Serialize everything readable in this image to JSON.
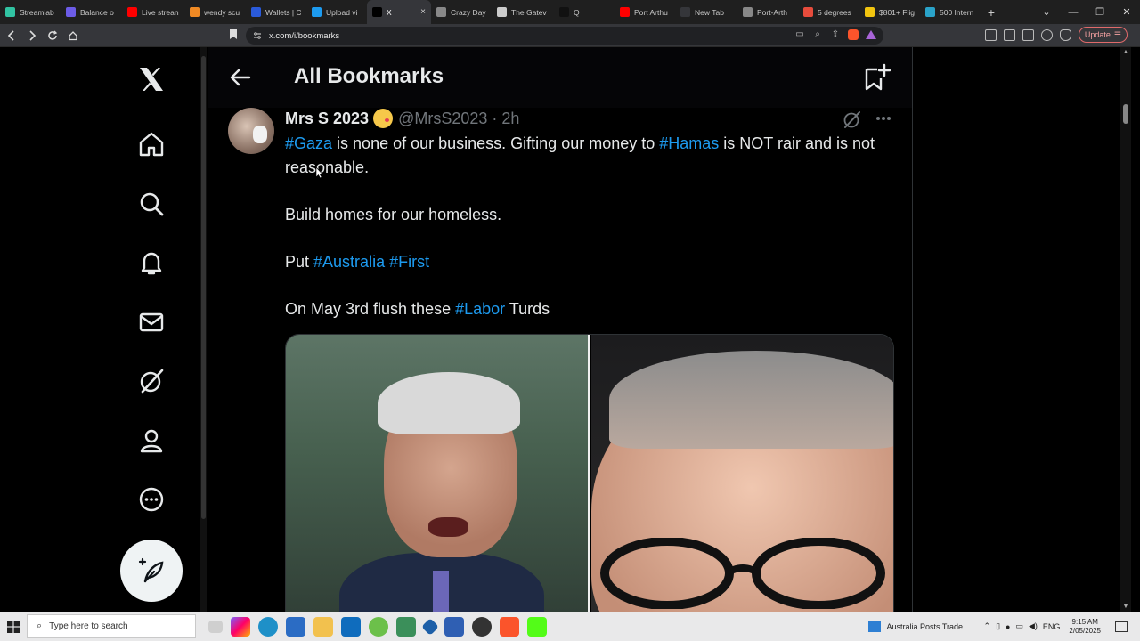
{
  "browser": {
    "tabs": [
      {
        "label": "Streamlab",
        "color": "#31c3a2",
        "active": false
      },
      {
        "label": "Balance o",
        "color": "#6c5ce7",
        "active": false
      },
      {
        "label": "Live strean",
        "color": "#ff0000",
        "active": false
      },
      {
        "label": "wendy scu",
        "color": "#f08a24",
        "active": false
      },
      {
        "label": "Wallets | C",
        "color": "#2a5ada",
        "active": false
      },
      {
        "label": "Upload vi",
        "color": "#1d9bf0",
        "active": false
      },
      {
        "label": "X",
        "color": "#000000",
        "active": true
      },
      {
        "label": "Crazy Day",
        "color": "#888888",
        "active": false
      },
      {
        "label": "The Gatev",
        "color": "#cccccc",
        "active": false
      },
      {
        "label": "Q",
        "color": "#111111",
        "active": false
      },
      {
        "label": "Port Arthu",
        "color": "#ff0000",
        "active": false
      },
      {
        "label": "New Tab",
        "color": "#35363a",
        "active": false
      },
      {
        "label": "Port-Arth",
        "color": "#888888",
        "active": false
      },
      {
        "label": "5 degrees",
        "color": "#e74c3c",
        "active": false
      },
      {
        "label": "$801+ Flig",
        "color": "#f1c40f",
        "active": false
      },
      {
        "label": "500 Intern",
        "color": "#2aa3c9",
        "active": false
      }
    ],
    "close_glyph": "×",
    "new_tab_glyph": "+",
    "url": "x.com/i/bookmarks",
    "update_label": "Update"
  },
  "page": {
    "header_title": "All Bookmarks"
  },
  "tweet": {
    "display_name": "Mrs S 2023",
    "handle": "@MrsS2023",
    "separator": "·",
    "time": "2h",
    "lines": [
      [
        {
          "t": "#Gaza",
          "tag": true
        },
        {
          "t": " is none of our business. Gifting our money to ",
          "tag": false
        },
        {
          "t": "#Hamas",
          "tag": true
        },
        {
          "t": " is NOT rair and is not reasonable.",
          "tag": false
        }
      ],
      [],
      [
        {
          "t": "Build homes for our homeless.",
          "tag": false
        }
      ],
      [],
      [
        {
          "t": "Put ",
          "tag": false
        },
        {
          "t": "#Australia",
          "tag": true
        },
        {
          "t": " ",
          "tag": false
        },
        {
          "t": "#First",
          "tag": true
        }
      ],
      [],
      [
        {
          "t": "On May 3rd flush these ",
          "tag": false
        },
        {
          "t": "#Labor",
          "tag": true
        },
        {
          "t": " Turds",
          "tag": false
        }
      ]
    ]
  },
  "taskbar": {
    "search_placeholder": "Type here to search",
    "news_text": "Australia Posts Trade...",
    "language": "ENG",
    "time": "9:15 AM",
    "date": "2/05/2025"
  },
  "colors": {
    "hashtag": "#1d9bf0",
    "text": "#e7e9ea",
    "muted": "#71767b"
  }
}
